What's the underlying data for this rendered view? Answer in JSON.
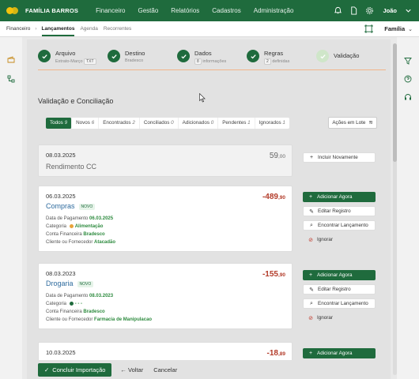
{
  "topbar": {
    "brand": "FAMÍLIA BARROS",
    "nav": [
      "Financeiro",
      "Gestão",
      "Relatórios",
      "Cadastros",
      "Administração"
    ],
    "user": "João",
    "bg_color": "#1f6b3d"
  },
  "subbar": {
    "crumb": "Financeiro",
    "active": "Lançamentos",
    "tabs": [
      "Agenda",
      "Recorrentes"
    ],
    "family": "Família"
  },
  "steps": [
    {
      "title": "Arquivo",
      "sub": "Extrato-Março",
      "badge": "TXT"
    },
    {
      "title": "Destino",
      "sub": "Bradesco"
    },
    {
      "title": "Dados",
      "sub": "informações",
      "badge": "8"
    },
    {
      "title": "Regras",
      "sub": "definidas",
      "badge": "2"
    },
    {
      "title": "Validação"
    }
  ],
  "section_title": "Validação e Conciliação",
  "filters": [
    {
      "label": "Todos",
      "count": "9"
    },
    {
      "label": "Novos",
      "count": "6"
    },
    {
      "label": "Encontrados",
      "count": "2"
    },
    {
      "label": "Conciliados",
      "count": "0"
    },
    {
      "label": "Adicionados",
      "count": "0"
    },
    {
      "label": "Pendentes",
      "count": "1"
    },
    {
      "label": "Ignorados",
      "count": "1"
    }
  ],
  "bulk_actions": "Ações em Lote",
  "cards": [
    {
      "date": "08.03.2025",
      "title": "Rendimento CC",
      "amount_int": "59",
      "amount_dec": ",00"
    },
    {
      "date": "06.03.2025",
      "title": "Compras",
      "tag": "NOVO",
      "amount_int": "-489",
      "amount_dec": ",90",
      "fields": {
        "pay_label": "Data de Pagamento",
        "pay_value": "06.03.2025",
        "cat_label": "Categoria",
        "cat_value": "Alimentação",
        "acc_label": "Conta Financeira",
        "acc_value": "Bradesco",
        "cli_label": "Cliente ou Fornecedor",
        "cli_value": "Atacadão"
      }
    },
    {
      "date": "08.03.2023",
      "title": "Drogaria",
      "tag": "NOVO",
      "amount_int": "-155",
      "amount_dec": ",90",
      "fields": {
        "pay_label": "Data de Pagamento",
        "pay_value": "08.03.2023",
        "cat_label": "Categoria",
        "cat_value": "- - -",
        "acc_label": "Conta Financeira",
        "acc_value": "Bradesco",
        "cli_label": "Cliente ou Fornecedor",
        "cli_value": "Farmacia de Manipulacao"
      }
    },
    {
      "date": "10.03.2025",
      "amount_int": "-18",
      "amount_dec": ",89"
    }
  ],
  "actions": {
    "include_again": "Incluir Novamente",
    "add_now": "Adicionar Agora",
    "edit": "Editar Registro",
    "find": "Encontrar Lançamento",
    "ignore": "Ignorar"
  },
  "bottom": {
    "conclude": "Concluir Importação",
    "back": "Voltar",
    "cancel": "Cancelar"
  },
  "colors": {
    "accent": "#1f6b3d",
    "negative": "#b33c2a",
    "link": "#2e6b9e",
    "highlight": "#2e8b3f",
    "category_dot": "#e8a33a"
  }
}
